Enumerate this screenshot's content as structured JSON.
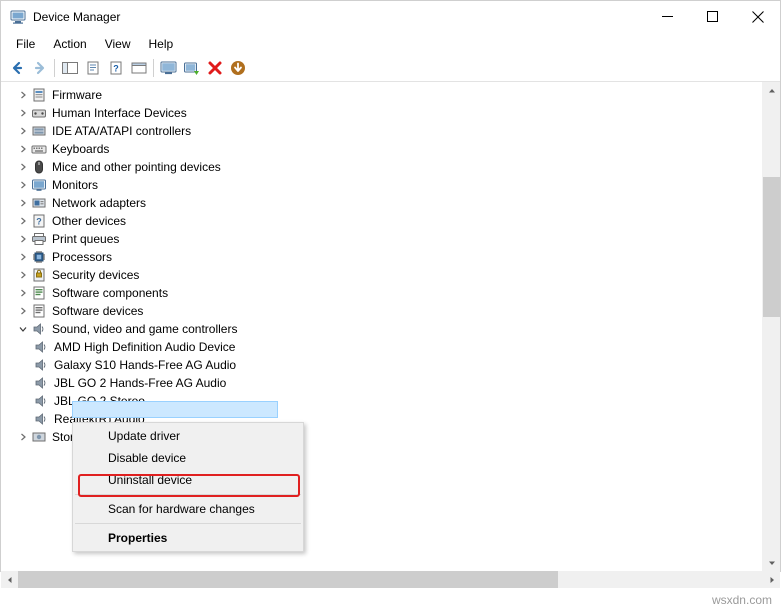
{
  "window": {
    "title": "Device Manager",
    "app_icon": "device-manager-icon",
    "minimize": "minimize-icon",
    "maximize": "maximize-icon",
    "close": "close-icon"
  },
  "menubar": {
    "items": [
      {
        "label": "File"
      },
      {
        "label": "Action"
      },
      {
        "label": "View"
      },
      {
        "label": "Help"
      }
    ]
  },
  "toolbar": {
    "buttons": [
      {
        "name": "back-button",
        "icon": "back-arrow-icon"
      },
      {
        "name": "forward-button",
        "icon": "forward-arrow-icon"
      },
      {
        "name": "show-hide-console-tree-button",
        "icon": "console-tree-icon"
      },
      {
        "name": "properties-button",
        "icon": "properties-icon"
      },
      {
        "name": "help-button",
        "icon": "question-mark-icon"
      },
      {
        "name": "view-button",
        "icon": "view-window-icon"
      },
      {
        "name": "scan-hardware-changes-button",
        "icon": "monitor-scan-icon"
      },
      {
        "name": "update-driver-button",
        "icon": "update-driver-icon"
      },
      {
        "name": "uninstall-device-button",
        "icon": "red-x-icon"
      },
      {
        "name": "disable-device-button",
        "icon": "down-arrow-circle-icon"
      }
    ]
  },
  "tree": {
    "items": [
      {
        "label": "Firmware",
        "icon": "firmware-icon",
        "indent": 1,
        "expander": "collapsed"
      },
      {
        "label": "Human Interface Devices",
        "icon": "hid-icon",
        "indent": 1,
        "expander": "collapsed"
      },
      {
        "label": "IDE ATA/ATAPI controllers",
        "icon": "ide-controller-icon",
        "indent": 1,
        "expander": "collapsed"
      },
      {
        "label": "Keyboards",
        "icon": "keyboard-icon",
        "indent": 1,
        "expander": "collapsed"
      },
      {
        "label": "Mice and other pointing devices",
        "icon": "mouse-icon",
        "indent": 1,
        "expander": "collapsed"
      },
      {
        "label": "Monitors",
        "icon": "monitor-icon",
        "indent": 1,
        "expander": "collapsed"
      },
      {
        "label": "Network adapters",
        "icon": "network-adapter-icon",
        "indent": 1,
        "expander": "collapsed"
      },
      {
        "label": "Other devices",
        "icon": "other-devices-icon",
        "indent": 1,
        "expander": "collapsed"
      },
      {
        "label": "Print queues",
        "icon": "print-queue-icon",
        "indent": 1,
        "expander": "collapsed"
      },
      {
        "label": "Processors",
        "icon": "processor-icon",
        "indent": 1,
        "expander": "collapsed"
      },
      {
        "label": "Security devices",
        "icon": "security-device-icon",
        "indent": 1,
        "expander": "collapsed"
      },
      {
        "label": "Software components",
        "icon": "software-component-icon",
        "indent": 1,
        "expander": "collapsed"
      },
      {
        "label": "Software devices",
        "icon": "software-device-icon",
        "indent": 1,
        "expander": "collapsed"
      },
      {
        "label": "Sound, video and game controllers",
        "icon": "sound-controller-icon",
        "indent": 1,
        "expander": "expanded"
      },
      {
        "label": "AMD High Definition Audio Device",
        "icon": "audio-device-icon",
        "indent": 2,
        "expander": "none",
        "selected": true
      },
      {
        "label": "Galaxy S10 Hands-Free AG Audio",
        "icon": "audio-device-icon",
        "indent": 2,
        "expander": "none"
      },
      {
        "label": "JBL GO 2 Hands-Free AG Audio",
        "icon": "audio-device-icon",
        "indent": 2,
        "expander": "none"
      },
      {
        "label": "JBL GO 2 Stereo",
        "icon": "audio-device-icon",
        "indent": 2,
        "expander": "none"
      },
      {
        "label": "Realtek(R) Audio",
        "icon": "audio-device-icon",
        "indent": 2,
        "expander": "none"
      },
      {
        "label": "Storage controllers",
        "icon": "storage-controller-icon",
        "indent": 1,
        "expander": "collapsed"
      }
    ]
  },
  "context_menu": {
    "items": [
      {
        "label": "Update driver",
        "bold": false,
        "separator_after": false
      },
      {
        "label": "Disable device",
        "bold": false,
        "separator_after": false
      },
      {
        "label": "Uninstall device",
        "bold": false,
        "separator_after": true,
        "highlighted": true
      },
      {
        "label": "Scan for hardware changes",
        "bold": false,
        "separator_after": true
      },
      {
        "label": "Properties",
        "bold": true,
        "separator_after": false
      }
    ]
  },
  "statusbar": {
    "watermark": "wsxdn.com"
  },
  "colors": {
    "highlight_box": "#e02020",
    "selection": "#cce8ff",
    "scrollbar_thumb": "#cdcdcd",
    "menu_bg": "#f0f0f0"
  }
}
